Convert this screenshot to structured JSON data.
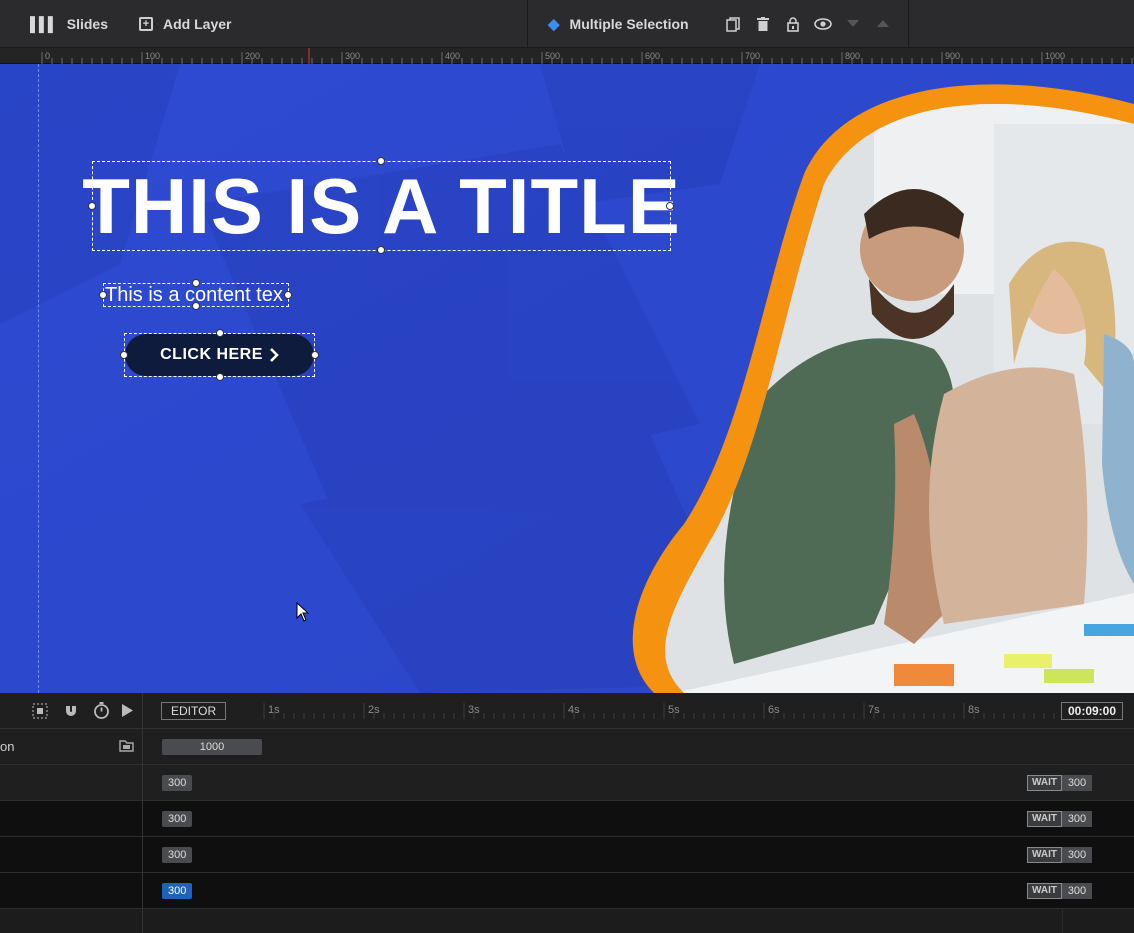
{
  "toolbar": {
    "slides_label": "Slides",
    "add_layer_label": "Add Layer",
    "multiple_selection_label": "Multiple Selection"
  },
  "ruler": {
    "labels": [
      "0",
      "100",
      "200",
      "300",
      "400",
      "500",
      "600",
      "700",
      "800",
      "900",
      "1000"
    ]
  },
  "canvas": {
    "title": "THIS IS A TITLE",
    "content": "This is a content tex",
    "button_label": "CLICK HERE",
    "background_color": "#2f4cd2",
    "accent_color": "#f5920f"
  },
  "timeline": {
    "editor_label": "EDITOR",
    "total_time": "00:09:00",
    "ticks": [
      "1s",
      "2s",
      "3s",
      "4s",
      "5s",
      "6s",
      "7s",
      "8s"
    ],
    "rows": [
      {
        "label": "on",
        "start": "1000",
        "wait": "",
        "end": ""
      },
      {
        "label": "",
        "start": "300",
        "wait": "WAIT",
        "end": "300"
      },
      {
        "label": "",
        "start": "300",
        "wait": "WAIT",
        "end": "300"
      },
      {
        "label": "",
        "start": "300",
        "wait": "WAIT",
        "end": "300"
      },
      {
        "label": "",
        "start": "300",
        "wait": "WAIT",
        "end": "300",
        "selected": true
      }
    ]
  }
}
